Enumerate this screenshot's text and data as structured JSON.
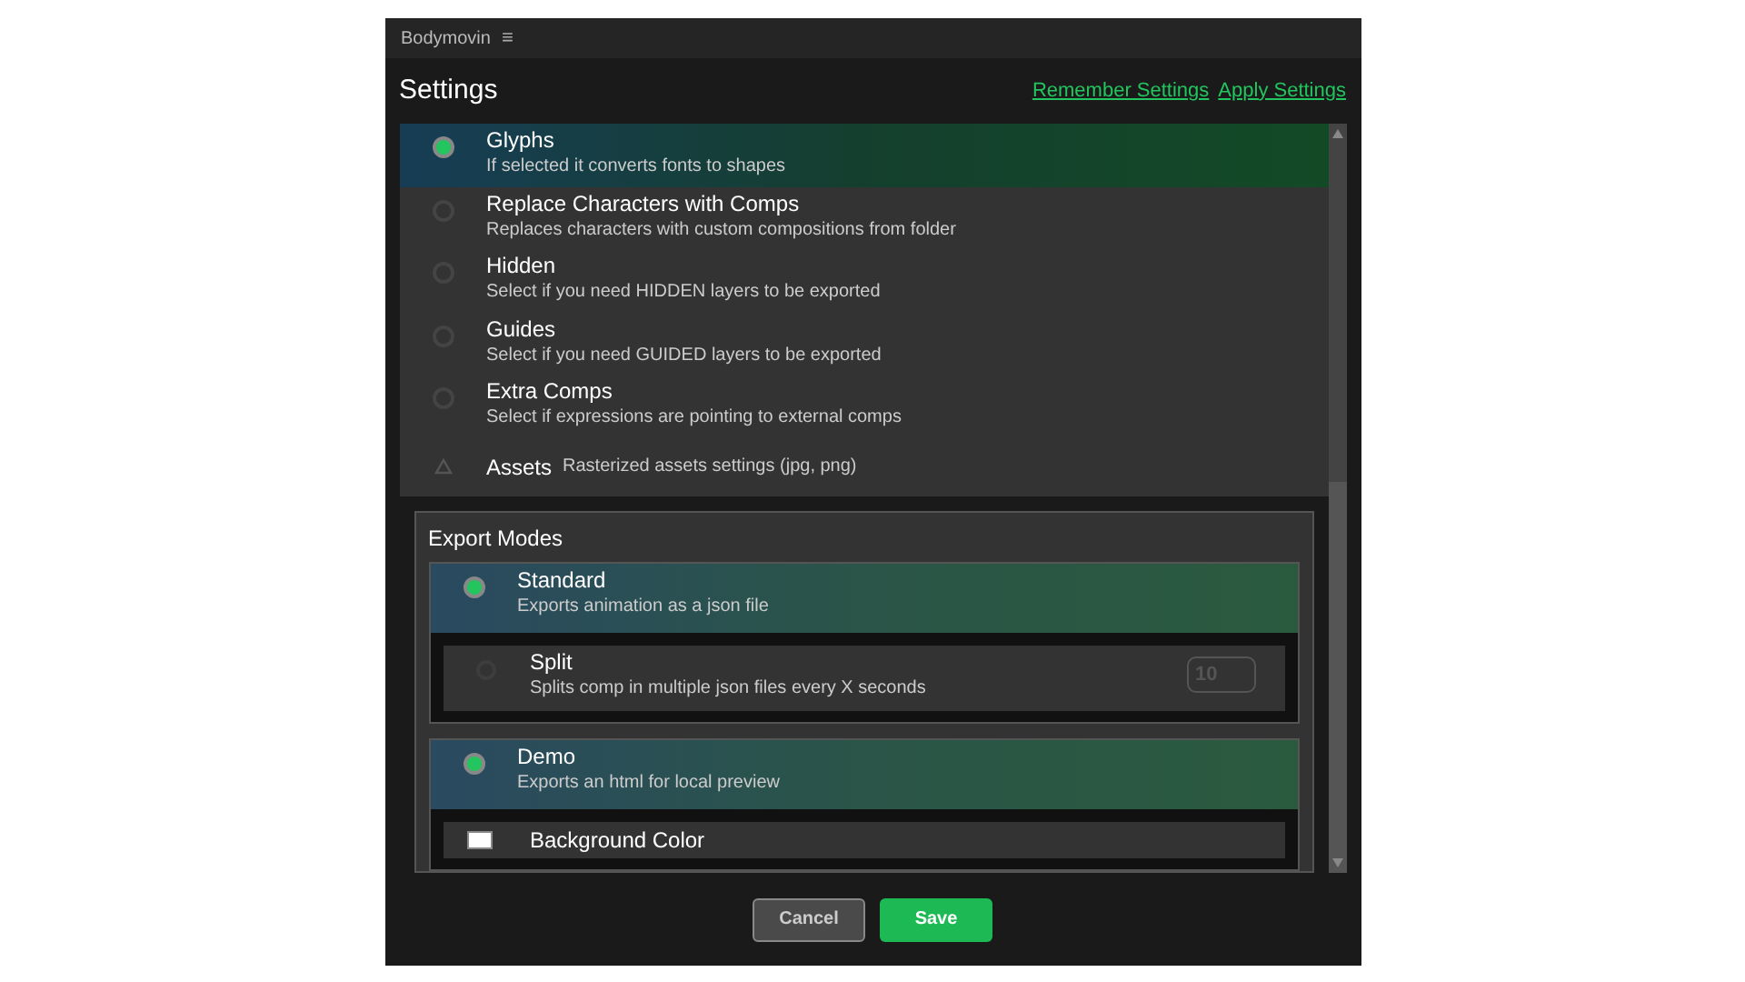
{
  "window": {
    "title": "Bodymovin",
    "menu_icon": "≡"
  },
  "header": {
    "title": "Settings",
    "links": [
      "Remember Settings",
      "Apply Settings"
    ]
  },
  "options": [
    {
      "kind": "radio",
      "label": "Glyphs",
      "description": "If selected it converts fonts to shapes",
      "selected": true
    },
    {
      "kind": "radio",
      "label": "Replace Characters with Comps",
      "description": "Replaces characters with custom compositions from folder",
      "selected": false
    },
    {
      "kind": "radio",
      "label": "Hidden",
      "description": "Select if you need HIDDEN layers to be exported",
      "selected": false
    },
    {
      "kind": "radio",
      "label": "Guides",
      "description": "Select if you need GUIDED layers to be exported",
      "selected": false
    },
    {
      "kind": "radio",
      "label": "Extra Comps",
      "description": "Select if expressions are pointing to external comps",
      "selected": false
    },
    {
      "kind": "section",
      "label": "Assets",
      "description": "Rasterized assets settings (jpg, png)",
      "expanded": false
    }
  ],
  "export_modes": {
    "title": "Export Modes",
    "modes": [
      {
        "label": "Standard",
        "description": "Exports animation as a json file",
        "selected": true,
        "children": [
          {
            "kind": "radio",
            "label": "Split",
            "description": "Splits comp in multiple json files every X seconds",
            "selected": false,
            "value": "10"
          }
        ]
      },
      {
        "label": "Demo",
        "description": "Exports an html for local preview",
        "selected": true,
        "children": [
          {
            "kind": "checkbox",
            "label": "Background Color",
            "checked": false
          }
        ]
      }
    ]
  },
  "buttons": [
    {
      "label": "Cancel",
      "kind": "secondary"
    },
    {
      "label": "Save",
      "kind": "primary"
    }
  ]
}
